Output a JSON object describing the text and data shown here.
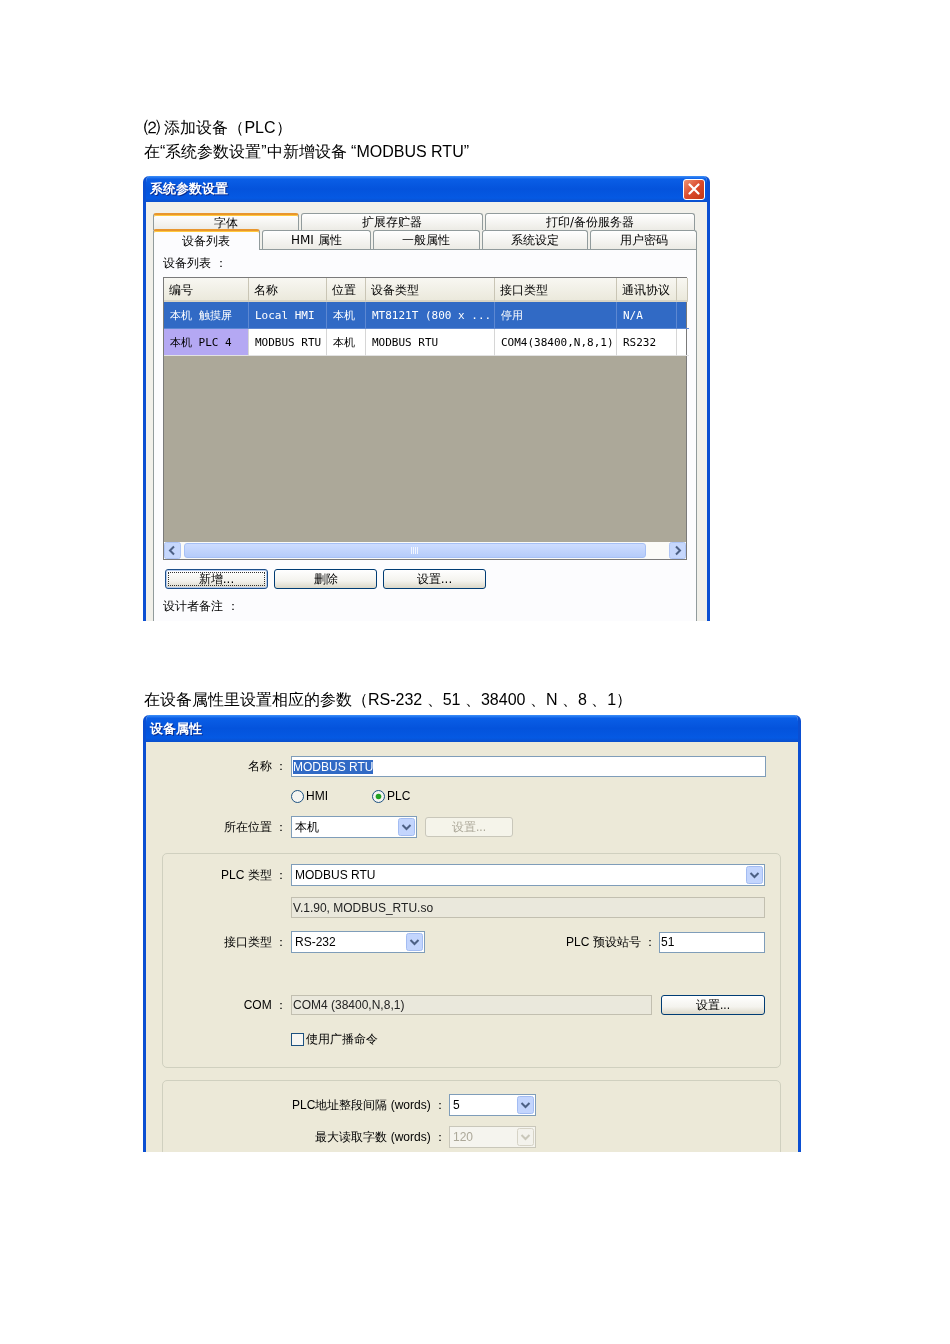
{
  "heading": "⑵ 添加设备（PLC）",
  "intro": "在“系统参数设置”中新增设备 “MODBUS RTU”",
  "system_dialog": {
    "title": "系统参数设置",
    "tab_rows": [
      {
        "tabs": [
          {
            "label": "字体",
            "selected": false,
            "hovered": true
          },
          {
            "label": "扩展存贮器",
            "selected": false,
            "hovered": false
          },
          {
            "label": "打印/备份服务器",
            "selected": false,
            "hovered": false
          }
        ]
      },
      {
        "tabs": [
          {
            "label": "设备列表",
            "selected": true,
            "hovered": false
          },
          {
            "label": "HMI 属性",
            "selected": false,
            "hovered": false
          },
          {
            "label": "一般属性",
            "selected": false,
            "hovered": false
          },
          {
            "label": "系统设定",
            "selected": false,
            "hovered": false
          },
          {
            "label": "用户密码",
            "selected": false,
            "hovered": false
          }
        ]
      }
    ],
    "list_label": "设备列表 ：",
    "table": {
      "columns": [
        "编号",
        "名称",
        "位置",
        "设备类型",
        "接口类型",
        "通讯协议"
      ],
      "rows": [
        {
          "selected": true,
          "cells": [
            "本机 触摸屏",
            "Local HMI",
            "本机",
            "MT8121T (800 x ...",
            "停用",
            "N/A"
          ]
        },
        {
          "selected": false,
          "cells": [
            "本机 PLC 4",
            "MODBUS RTU",
            "本机",
            "MODBUS RTU",
            "COM4(38400,N,8,1)",
            "RS232"
          ]
        }
      ]
    },
    "buttons": [
      {
        "label": "新增...",
        "focused": true
      },
      {
        "label": "删除",
        "focused": false
      },
      {
        "label": "设置...",
        "focused": false
      }
    ],
    "notes_label": "设计者备注 ："
  },
  "caption": "在设备属性里设置相应的参数（RS-232 、51 、38400 、N 、8 、1）",
  "device_dialog": {
    "title": "设备属性",
    "name": {
      "label": "名称 ：",
      "value": "MODBUS RTU",
      "value_selected": true
    },
    "device_types": [
      {
        "label": "HMI",
        "selected": false
      },
      {
        "label": "PLC",
        "selected": true
      }
    ],
    "location": {
      "label": "所在位置 ：",
      "value": "本机",
      "button": {
        "label": "设置...",
        "disabled": true
      }
    },
    "plc_group": {
      "plc_type": {
        "label": "PLC 类型 ：",
        "value": "MODBUS RTU"
      },
      "driver_info": "V.1.90, MODBUS_RTU.so",
      "interface": {
        "label": "接口类型 ：",
        "value": "RS-232"
      },
      "station": {
        "label": "PLC 预设站号 ：",
        "value": "51"
      },
      "com": {
        "label": "COM ：",
        "value": "COM4 (38400,N,8,1)",
        "button": {
          "label": "设置...",
          "disabled": false
        }
      },
      "broadcast": {
        "label": "使用广播命令",
        "checked": false
      }
    },
    "address_group": {
      "rows": [
        {
          "label": "PLC地址整段间隔 (words) ：",
          "value": "5",
          "disabled": false
        },
        {
          "label": "最大读取字数 (words) ：",
          "value": "120",
          "disabled": true
        }
      ]
    }
  }
}
